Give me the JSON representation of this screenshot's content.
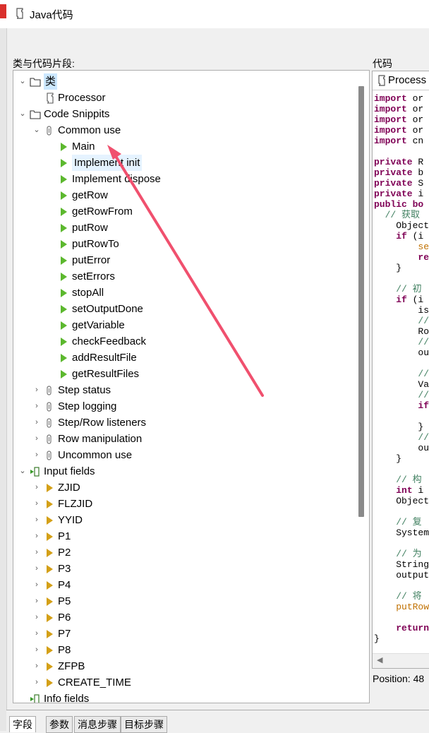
{
  "window": {
    "title": "Java代码"
  },
  "labels": {
    "classes_and_snippets": "类与代码片段:",
    "code": "代码"
  },
  "tree": {
    "rows": [
      {
        "label": "类",
        "indent": 0,
        "twisty": "open",
        "icon": "folder-icon",
        "selected": true
      },
      {
        "label": "Processor",
        "indent": 1,
        "twisty": "none",
        "icon": "script-icon"
      },
      {
        "label": "Code Snippits",
        "indent": 0,
        "twisty": "open",
        "icon": "folder-icon"
      },
      {
        "label": "Common use",
        "indent": 1,
        "twisty": "open",
        "icon": "snippet-group-icon"
      },
      {
        "label": "Main",
        "indent": 2,
        "twisty": "none",
        "icon": "snippet-icon"
      },
      {
        "label": "Implement init",
        "indent": 2,
        "twisty": "none",
        "icon": "snippet-icon",
        "hover": true
      },
      {
        "label": "Implement dispose",
        "indent": 2,
        "twisty": "none",
        "icon": "snippet-icon"
      },
      {
        "label": "getRow",
        "indent": 2,
        "twisty": "none",
        "icon": "snippet-icon"
      },
      {
        "label": "getRowFrom",
        "indent": 2,
        "twisty": "none",
        "icon": "snippet-icon"
      },
      {
        "label": "putRow",
        "indent": 2,
        "twisty": "none",
        "icon": "snippet-icon"
      },
      {
        "label": "putRowTo",
        "indent": 2,
        "twisty": "none",
        "icon": "snippet-icon"
      },
      {
        "label": "putError",
        "indent": 2,
        "twisty": "none",
        "icon": "snippet-icon"
      },
      {
        "label": "setErrors",
        "indent": 2,
        "twisty": "none",
        "icon": "snippet-icon"
      },
      {
        "label": "stopAll",
        "indent": 2,
        "twisty": "none",
        "icon": "snippet-icon"
      },
      {
        "label": "setOutputDone",
        "indent": 2,
        "twisty": "none",
        "icon": "snippet-icon"
      },
      {
        "label": "getVariable",
        "indent": 2,
        "twisty": "none",
        "icon": "snippet-icon"
      },
      {
        "label": "checkFeedback",
        "indent": 2,
        "twisty": "none",
        "icon": "snippet-icon"
      },
      {
        "label": "addResultFile",
        "indent": 2,
        "twisty": "none",
        "icon": "snippet-icon"
      },
      {
        "label": "getResultFiles",
        "indent": 2,
        "twisty": "none",
        "icon": "snippet-icon"
      },
      {
        "label": "Step status",
        "indent": 1,
        "twisty": "closed",
        "icon": "snippet-group-icon"
      },
      {
        "label": "Step logging",
        "indent": 1,
        "twisty": "closed",
        "icon": "snippet-group-icon"
      },
      {
        "label": "Step/Row listeners",
        "indent": 1,
        "twisty": "closed",
        "icon": "snippet-group-icon"
      },
      {
        "label": "Row manipulation",
        "indent": 1,
        "twisty": "closed",
        "icon": "snippet-group-icon"
      },
      {
        "label": "Uncommon use",
        "indent": 1,
        "twisty": "closed",
        "icon": "snippet-group-icon"
      },
      {
        "label": "Input fields",
        "indent": 0,
        "twisty": "open",
        "icon": "input-fields-icon"
      },
      {
        "label": "ZJID",
        "indent": 1,
        "twisty": "closed",
        "icon": "field-icon"
      },
      {
        "label": "FLZJID",
        "indent": 1,
        "twisty": "closed",
        "icon": "field-icon"
      },
      {
        "label": "YYID",
        "indent": 1,
        "twisty": "closed",
        "icon": "field-icon"
      },
      {
        "label": "P1",
        "indent": 1,
        "twisty": "closed",
        "icon": "field-icon"
      },
      {
        "label": "P2",
        "indent": 1,
        "twisty": "closed",
        "icon": "field-icon"
      },
      {
        "label": "P3",
        "indent": 1,
        "twisty": "closed",
        "icon": "field-icon"
      },
      {
        "label": "P4",
        "indent": 1,
        "twisty": "closed",
        "icon": "field-icon"
      },
      {
        "label": "P5",
        "indent": 1,
        "twisty": "closed",
        "icon": "field-icon"
      },
      {
        "label": "P6",
        "indent": 1,
        "twisty": "closed",
        "icon": "field-icon"
      },
      {
        "label": "P7",
        "indent": 1,
        "twisty": "closed",
        "icon": "field-icon"
      },
      {
        "label": "P8",
        "indent": 1,
        "twisty": "closed",
        "icon": "field-icon"
      },
      {
        "label": "ZFPB",
        "indent": 1,
        "twisty": "closed",
        "icon": "field-icon"
      },
      {
        "label": "CREATE_TIME",
        "indent": 1,
        "twisty": "closed",
        "icon": "field-icon"
      },
      {
        "label": "Info fields",
        "indent": 0,
        "twisty": "none",
        "icon": "input-fields-icon"
      }
    ]
  },
  "code_editor": {
    "tab_label": "Process",
    "lines": [
      {
        "parts": [
          {
            "t": "import",
            "c": "kw"
          },
          {
            "t": " or",
            "c": ""
          }
        ]
      },
      {
        "parts": [
          {
            "t": "import",
            "c": "kw"
          },
          {
            "t": " or",
            "c": ""
          }
        ]
      },
      {
        "parts": [
          {
            "t": "import",
            "c": "kw"
          },
          {
            "t": " or",
            "c": ""
          }
        ]
      },
      {
        "parts": [
          {
            "t": "import",
            "c": "kw"
          },
          {
            "t": " or",
            "c": ""
          }
        ]
      },
      {
        "parts": [
          {
            "t": "import",
            "c": "kw"
          },
          {
            "t": " cn",
            "c": ""
          }
        ]
      },
      {
        "parts": [
          {
            "t": "",
            "c": ""
          }
        ]
      },
      {
        "parts": [
          {
            "t": "private",
            "c": "kw"
          },
          {
            "t": " R",
            "c": ""
          }
        ]
      },
      {
        "parts": [
          {
            "t": "private",
            "c": "kw"
          },
          {
            "t": " b",
            "c": ""
          }
        ]
      },
      {
        "parts": [
          {
            "t": "private",
            "c": "kw"
          },
          {
            "t": " S",
            "c": ""
          }
        ]
      },
      {
        "parts": [
          {
            "t": "private",
            "c": "kw"
          },
          {
            "t": " i",
            "c": ""
          }
        ]
      },
      {
        "parts": [
          {
            "t": "public",
            "c": "kw"
          },
          {
            "t": " ",
            "c": ""
          },
          {
            "t": "bo",
            "c": "kw"
          }
        ]
      },
      {
        "parts": [
          {
            "t": "  // 获取",
            "c": "cm"
          }
        ]
      },
      {
        "parts": [
          {
            "t": "    Object",
            "c": ""
          }
        ]
      },
      {
        "parts": [
          {
            "t": "    ",
            "c": ""
          },
          {
            "t": "if",
            "c": "kw"
          },
          {
            "t": " (i",
            "c": ""
          }
        ]
      },
      {
        "parts": [
          {
            "t": "        ",
            "c": ""
          },
          {
            "t": "se",
            "c": "fn"
          }
        ]
      },
      {
        "parts": [
          {
            "t": "        ",
            "c": ""
          },
          {
            "t": "re",
            "c": "kw"
          }
        ]
      },
      {
        "parts": [
          {
            "t": "    }",
            "c": ""
          }
        ]
      },
      {
        "parts": [
          {
            "t": "",
            "c": ""
          }
        ]
      },
      {
        "parts": [
          {
            "t": "    // 初",
            "c": "cm"
          }
        ]
      },
      {
        "parts": [
          {
            "t": "    ",
            "c": ""
          },
          {
            "t": "if",
            "c": "kw"
          },
          {
            "t": " (i",
            "c": ""
          }
        ]
      },
      {
        "parts": [
          {
            "t": "        is",
            "c": ""
          }
        ]
      },
      {
        "parts": [
          {
            "t": "        //",
            "c": "cm"
          }
        ]
      },
      {
        "parts": [
          {
            "t": "        Ro",
            "c": ""
          }
        ]
      },
      {
        "parts": [
          {
            "t": "        //",
            "c": "cm"
          }
        ]
      },
      {
        "parts": [
          {
            "t": "        ou",
            "c": ""
          }
        ]
      },
      {
        "parts": [
          {
            "t": "",
            "c": ""
          }
        ]
      },
      {
        "parts": [
          {
            "t": "        //",
            "c": "cm"
          }
        ]
      },
      {
        "parts": [
          {
            "t": "        Va",
            "c": ""
          }
        ]
      },
      {
        "parts": [
          {
            "t": "        //",
            "c": "cm"
          }
        ]
      },
      {
        "parts": [
          {
            "t": "        ",
            "c": ""
          },
          {
            "t": "if",
            "c": "kw"
          }
        ]
      },
      {
        "parts": [
          {
            "t": "",
            "c": ""
          }
        ]
      },
      {
        "parts": [
          {
            "t": "        }",
            "c": ""
          }
        ]
      },
      {
        "parts": [
          {
            "t": "        //",
            "c": "cm"
          }
        ]
      },
      {
        "parts": [
          {
            "t": "        ou",
            "c": ""
          }
        ]
      },
      {
        "parts": [
          {
            "t": "    }",
            "c": ""
          }
        ]
      },
      {
        "parts": [
          {
            "t": "",
            "c": ""
          }
        ]
      },
      {
        "parts": [
          {
            "t": "    // 构",
            "c": "cm"
          }
        ]
      },
      {
        "parts": [
          {
            "t": "    ",
            "c": ""
          },
          {
            "t": "int",
            "c": "kw"
          },
          {
            "t": " i",
            "c": ""
          }
        ]
      },
      {
        "parts": [
          {
            "t": "    Object",
            "c": ""
          }
        ]
      },
      {
        "parts": [
          {
            "t": "",
            "c": ""
          }
        ]
      },
      {
        "parts": [
          {
            "t": "    // 复",
            "c": "cm"
          }
        ]
      },
      {
        "parts": [
          {
            "t": "    System",
            "c": ""
          }
        ]
      },
      {
        "parts": [
          {
            "t": "",
            "c": ""
          }
        ]
      },
      {
        "parts": [
          {
            "t": "    // 为",
            "c": "cm"
          }
        ]
      },
      {
        "parts": [
          {
            "t": "    String",
            "c": ""
          }
        ]
      },
      {
        "parts": [
          {
            "t": "    output",
            "c": ""
          }
        ]
      },
      {
        "parts": [
          {
            "t": "",
            "c": ""
          }
        ]
      },
      {
        "parts": [
          {
            "t": "    // 将",
            "c": "cm"
          }
        ]
      },
      {
        "parts": [
          {
            "t": "    ",
            "c": ""
          },
          {
            "t": "putRow",
            "c": "fn"
          }
        ]
      },
      {
        "parts": [
          {
            "t": "",
            "c": ""
          }
        ]
      },
      {
        "parts": [
          {
            "t": "    ",
            "c": ""
          },
          {
            "t": "return",
            "c": "kw"
          }
        ]
      },
      {
        "parts": [
          {
            "t": "}",
            "c": ""
          }
        ]
      }
    ]
  },
  "status": {
    "position": "Position: 48"
  },
  "bottom_tabs": [
    {
      "label": "字段",
      "active": true
    },
    {
      "label": "参数",
      "active": false
    },
    {
      "label": "消息步骤",
      "active": false
    },
    {
      "label": "目标步骤",
      "active": false
    }
  ],
  "colors": {
    "annotation_arrow": "#f0506e",
    "selection": "#cce8ff",
    "snippet_green": "#5cb82e",
    "field_orange": "#d4a017"
  }
}
